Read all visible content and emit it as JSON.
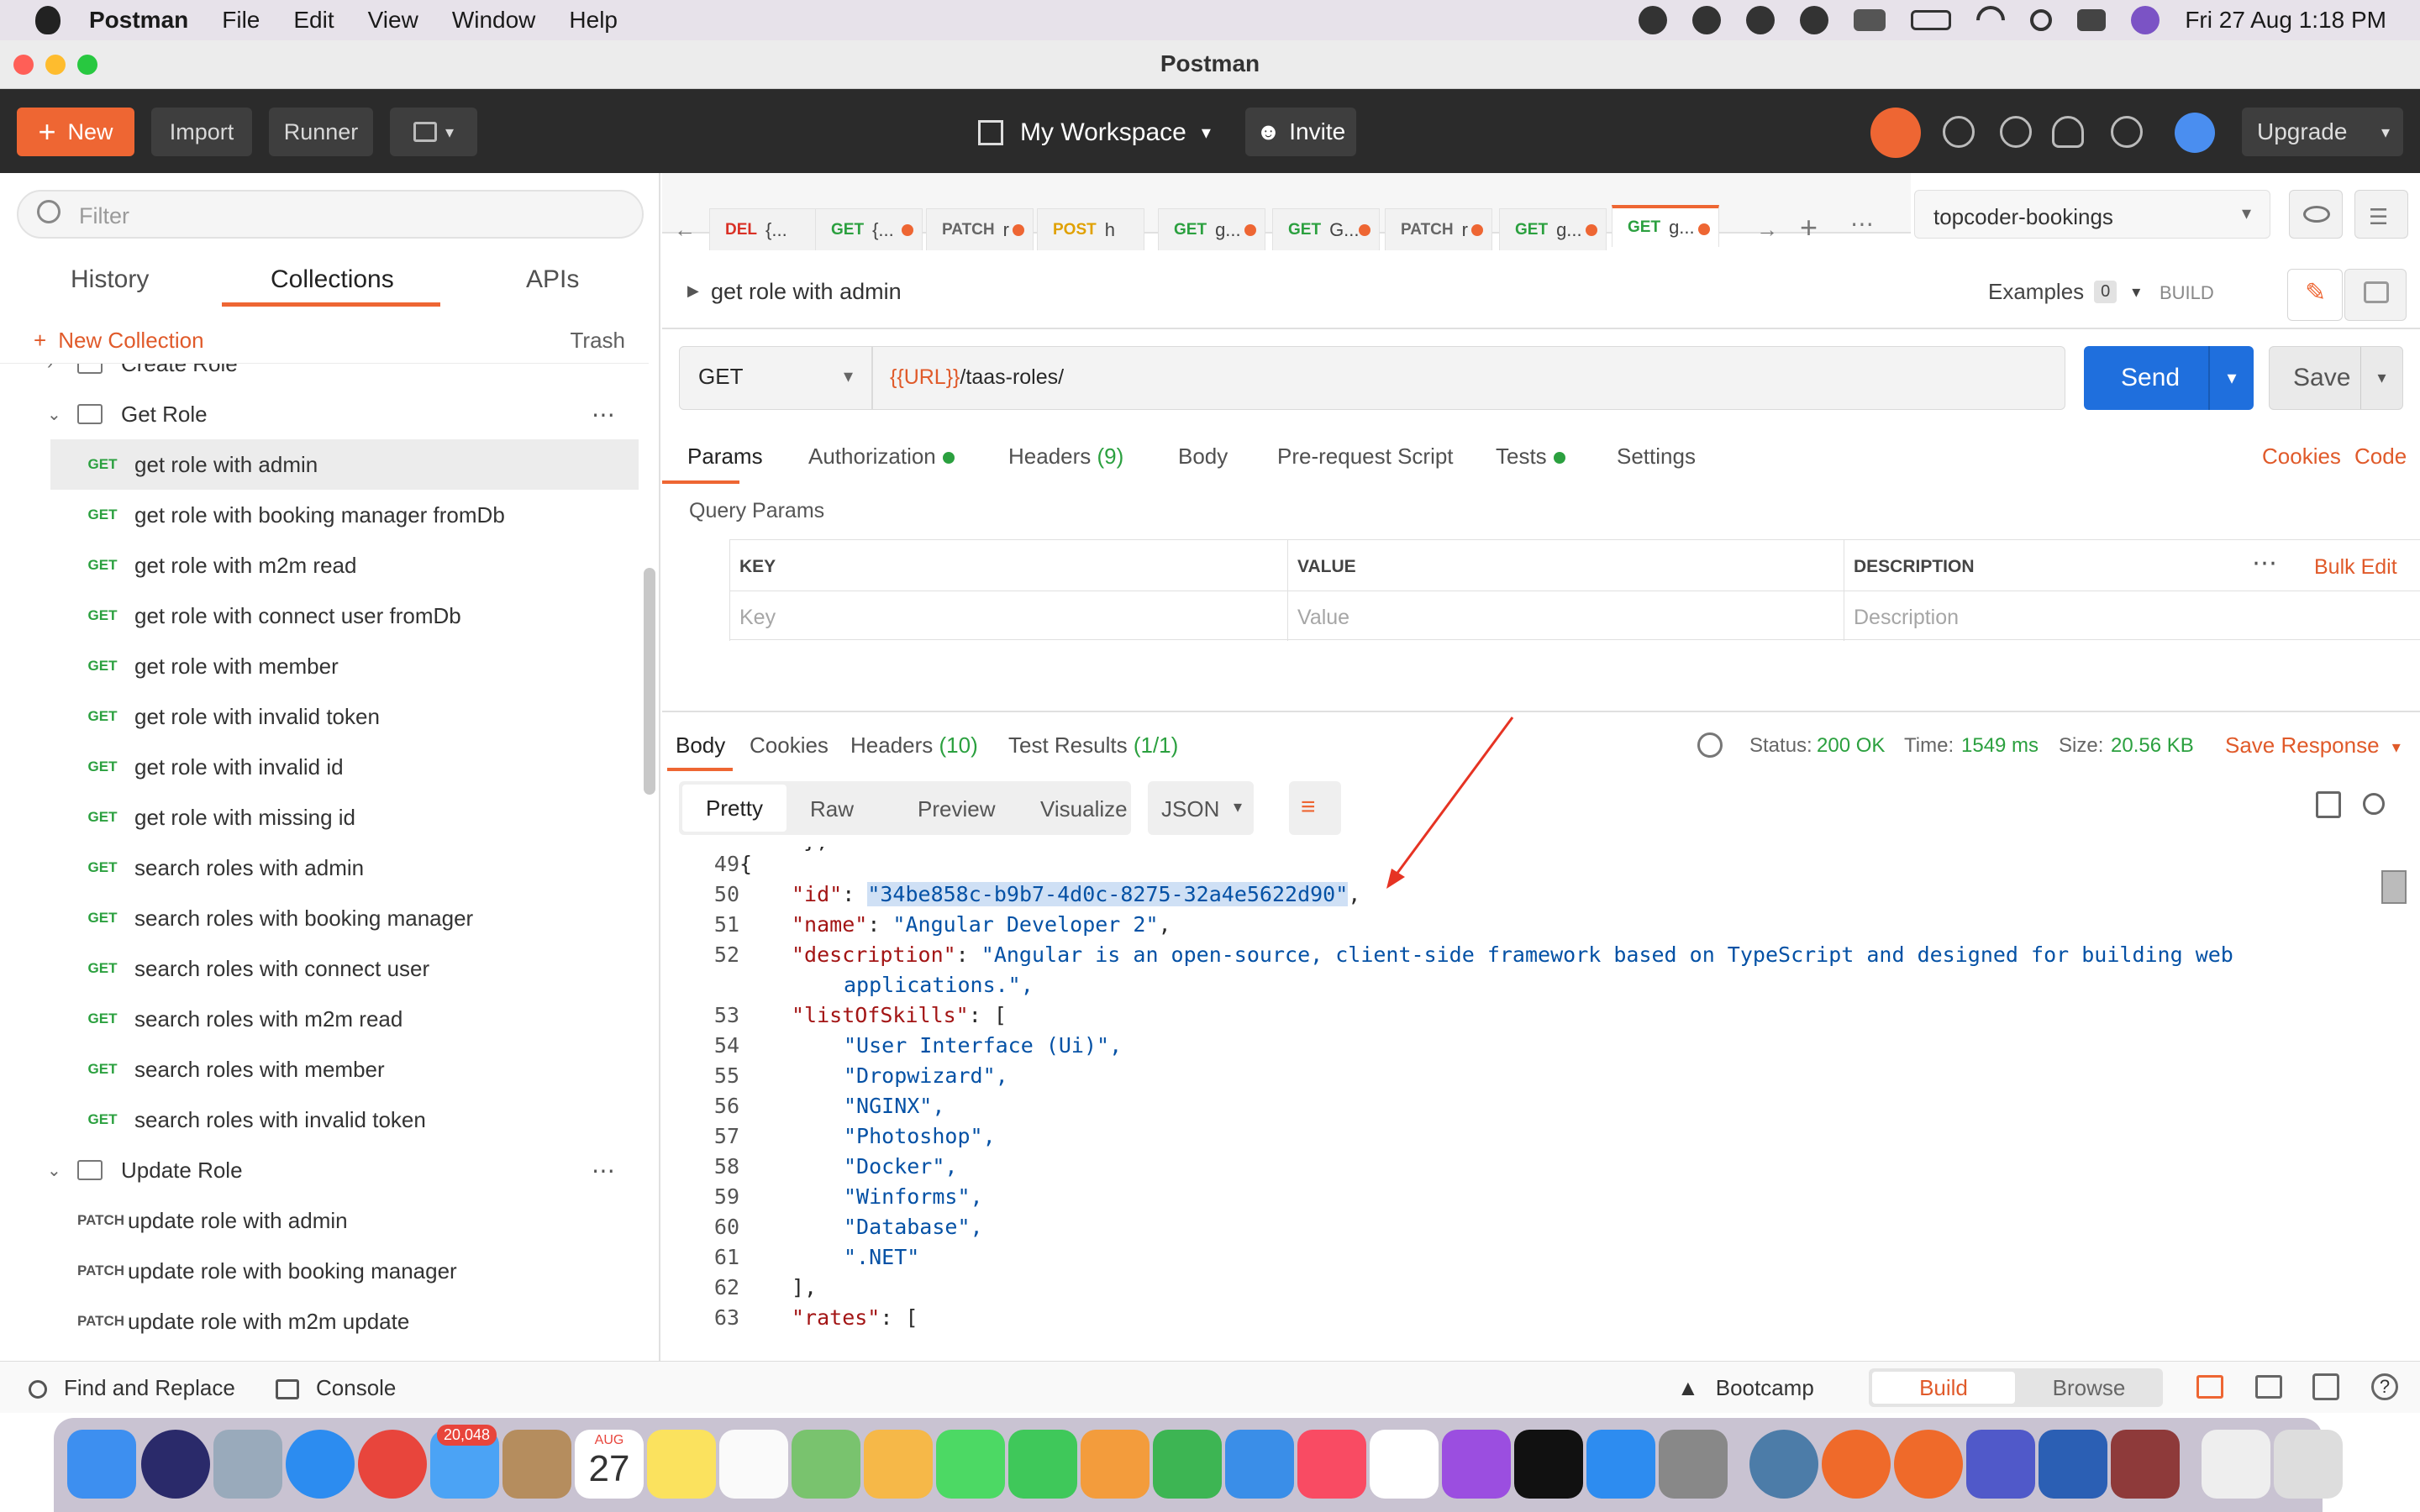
{
  "menubar": {
    "app": "Postman",
    "items": [
      "File",
      "Edit",
      "View",
      "Window",
      "Help"
    ],
    "clock": "Fri 27 Aug  1:18 PM"
  },
  "window": {
    "title": "Postman"
  },
  "header": {
    "new": "New",
    "import": "Import",
    "runner": "Runner",
    "workspace": "My Workspace",
    "invite": "Invite",
    "upgrade": "Upgrade",
    "accent": "#ee6633"
  },
  "sidebar": {
    "filter_placeholder": "Filter",
    "tabs": [
      "History",
      "Collections",
      "APIs"
    ],
    "new_collection": "New Collection",
    "trash": "Trash",
    "tree": [
      {
        "type": "folder",
        "label": "Create Role",
        "open": false
      },
      {
        "type": "folder",
        "label": "Get Role",
        "open": true
      },
      {
        "type": "request",
        "method": "GET",
        "label": "get role with admin",
        "selected": true
      },
      {
        "type": "request",
        "method": "GET",
        "label": "get role with booking manager fromDb"
      },
      {
        "type": "request",
        "method": "GET",
        "label": "get role with m2m read"
      },
      {
        "type": "request",
        "method": "GET",
        "label": "get role with connect user fromDb"
      },
      {
        "type": "request",
        "method": "GET",
        "label": "get role with member"
      },
      {
        "type": "request",
        "method": "GET",
        "label": "get role with invalid token"
      },
      {
        "type": "request",
        "method": "GET",
        "label": "get role with invalid id"
      },
      {
        "type": "request",
        "method": "GET",
        "label": "get role with missing id"
      },
      {
        "type": "request",
        "method": "GET",
        "label": "search roles with admin"
      },
      {
        "type": "request",
        "method": "GET",
        "label": "search roles with booking manager"
      },
      {
        "type": "request",
        "method": "GET",
        "label": "search roles with connect user"
      },
      {
        "type": "request",
        "method": "GET",
        "label": "search roles with m2m read"
      },
      {
        "type": "request",
        "method": "GET",
        "label": "search roles with member"
      },
      {
        "type": "request",
        "method": "GET",
        "label": "search roles with invalid token"
      },
      {
        "type": "folder",
        "label": "Update Role",
        "open": true
      },
      {
        "type": "request",
        "method": "PATCH",
        "label": "update role with admin"
      },
      {
        "type": "request",
        "method": "PATCH",
        "label": "update role with booking manager"
      },
      {
        "type": "request",
        "method": "PATCH",
        "label": "update role with m2m update"
      }
    ]
  },
  "request_tabs": [
    {
      "method": "DEL",
      "name": "{..."
    },
    {
      "method": "GET",
      "name": "{..."
    },
    {
      "method": "PATCH",
      "name": "r"
    },
    {
      "method": "POST",
      "name": "h"
    },
    {
      "method": "GET",
      "name": "g..."
    },
    {
      "method": "GET",
      "name": "G..."
    },
    {
      "method": "PATCH",
      "name": "r"
    },
    {
      "method": "GET",
      "name": "g..."
    },
    {
      "method": "GET",
      "name": "g...",
      "active": true
    }
  ],
  "environment": "topcoder-bookings",
  "request": {
    "title": "get role with admin",
    "examples_label": "Examples",
    "examples_count": "0",
    "build": "BUILD",
    "method": "GET",
    "url_var": "{{URL}}",
    "url_path": "/taas-roles/",
    "send": "Send",
    "save": "Save",
    "tabs": [
      {
        "label": "Params"
      },
      {
        "label": "Authorization"
      },
      {
        "label": "Headers",
        "count": "(9)"
      },
      {
        "label": "Body"
      },
      {
        "label": "Pre-request Script"
      },
      {
        "label": "Tests"
      },
      {
        "label": "Settings"
      }
    ],
    "cookies": "Cookies",
    "code": "Code",
    "query_params": "Query Params",
    "columns": [
      "KEY",
      "VALUE",
      "DESCRIPTION"
    ],
    "bulk_edit": "Bulk Edit",
    "placeholders": [
      "Key",
      "Value",
      "Description"
    ]
  },
  "response": {
    "tabs": [
      {
        "label": "Body"
      },
      {
        "label": "Cookies"
      },
      {
        "label": "Headers",
        "count": "(10)"
      },
      {
        "label": "Test Results",
        "count": "(1/1)"
      }
    ],
    "status_label": "Status:",
    "status": "200 OK",
    "time_label": "Time:",
    "time": "1549 ms",
    "size_label": "Size:",
    "size": "20.56 KB",
    "save_response": "Save Response",
    "views": [
      "Pretty",
      "Raw",
      "Preview",
      "Visualize"
    ],
    "format": "JSON",
    "lines": [
      {
        "n": "49",
        "t": "{"
      },
      {
        "n": "50",
        "key": "\"id\"",
        "val": "\"34be858c-b9b7-4d0c-8275-32a4e5622d90\"",
        "end": ","
      },
      {
        "n": "51",
        "key": "\"name\"",
        "val": "\"Angular Developer 2\"",
        "end": ","
      },
      {
        "n": "52",
        "key": "\"description\"",
        "val": "\"Angular is an open-source, client-side framework based on TypeScript and designed for building web",
        "end": ""
      },
      {
        "n": "",
        "cont": "applications.\","
      },
      {
        "n": "53",
        "key": "\"listOfSkills\"",
        "val": "[",
        "end": "",
        "valplain": true
      },
      {
        "n": "54",
        "item": "\"User Interface (Ui)\","
      },
      {
        "n": "55",
        "item": "\"Dropwizard\","
      },
      {
        "n": "56",
        "item": "\"NGINX\","
      },
      {
        "n": "57",
        "item": "\"Photoshop\","
      },
      {
        "n": "58",
        "item": "\"Docker\","
      },
      {
        "n": "59",
        "item": "\"Winforms\","
      },
      {
        "n": "60",
        "item": "\"Database\","
      },
      {
        "n": "61",
        "item": "\".NET\""
      },
      {
        "n": "62",
        "t": "],"
      },
      {
        "n": "63",
        "key": "\"rates\"",
        "val": "[",
        "end": "",
        "valplain": true
      }
    ]
  },
  "statusbar": {
    "find_replace": "Find and Replace",
    "console": "Console",
    "bootcamp": "Bootcamp",
    "build": "Build",
    "browse": "Browse"
  },
  "dock": {
    "calendar_month": "AUG",
    "calendar_day": "27",
    "mail_badge": "20,048"
  }
}
